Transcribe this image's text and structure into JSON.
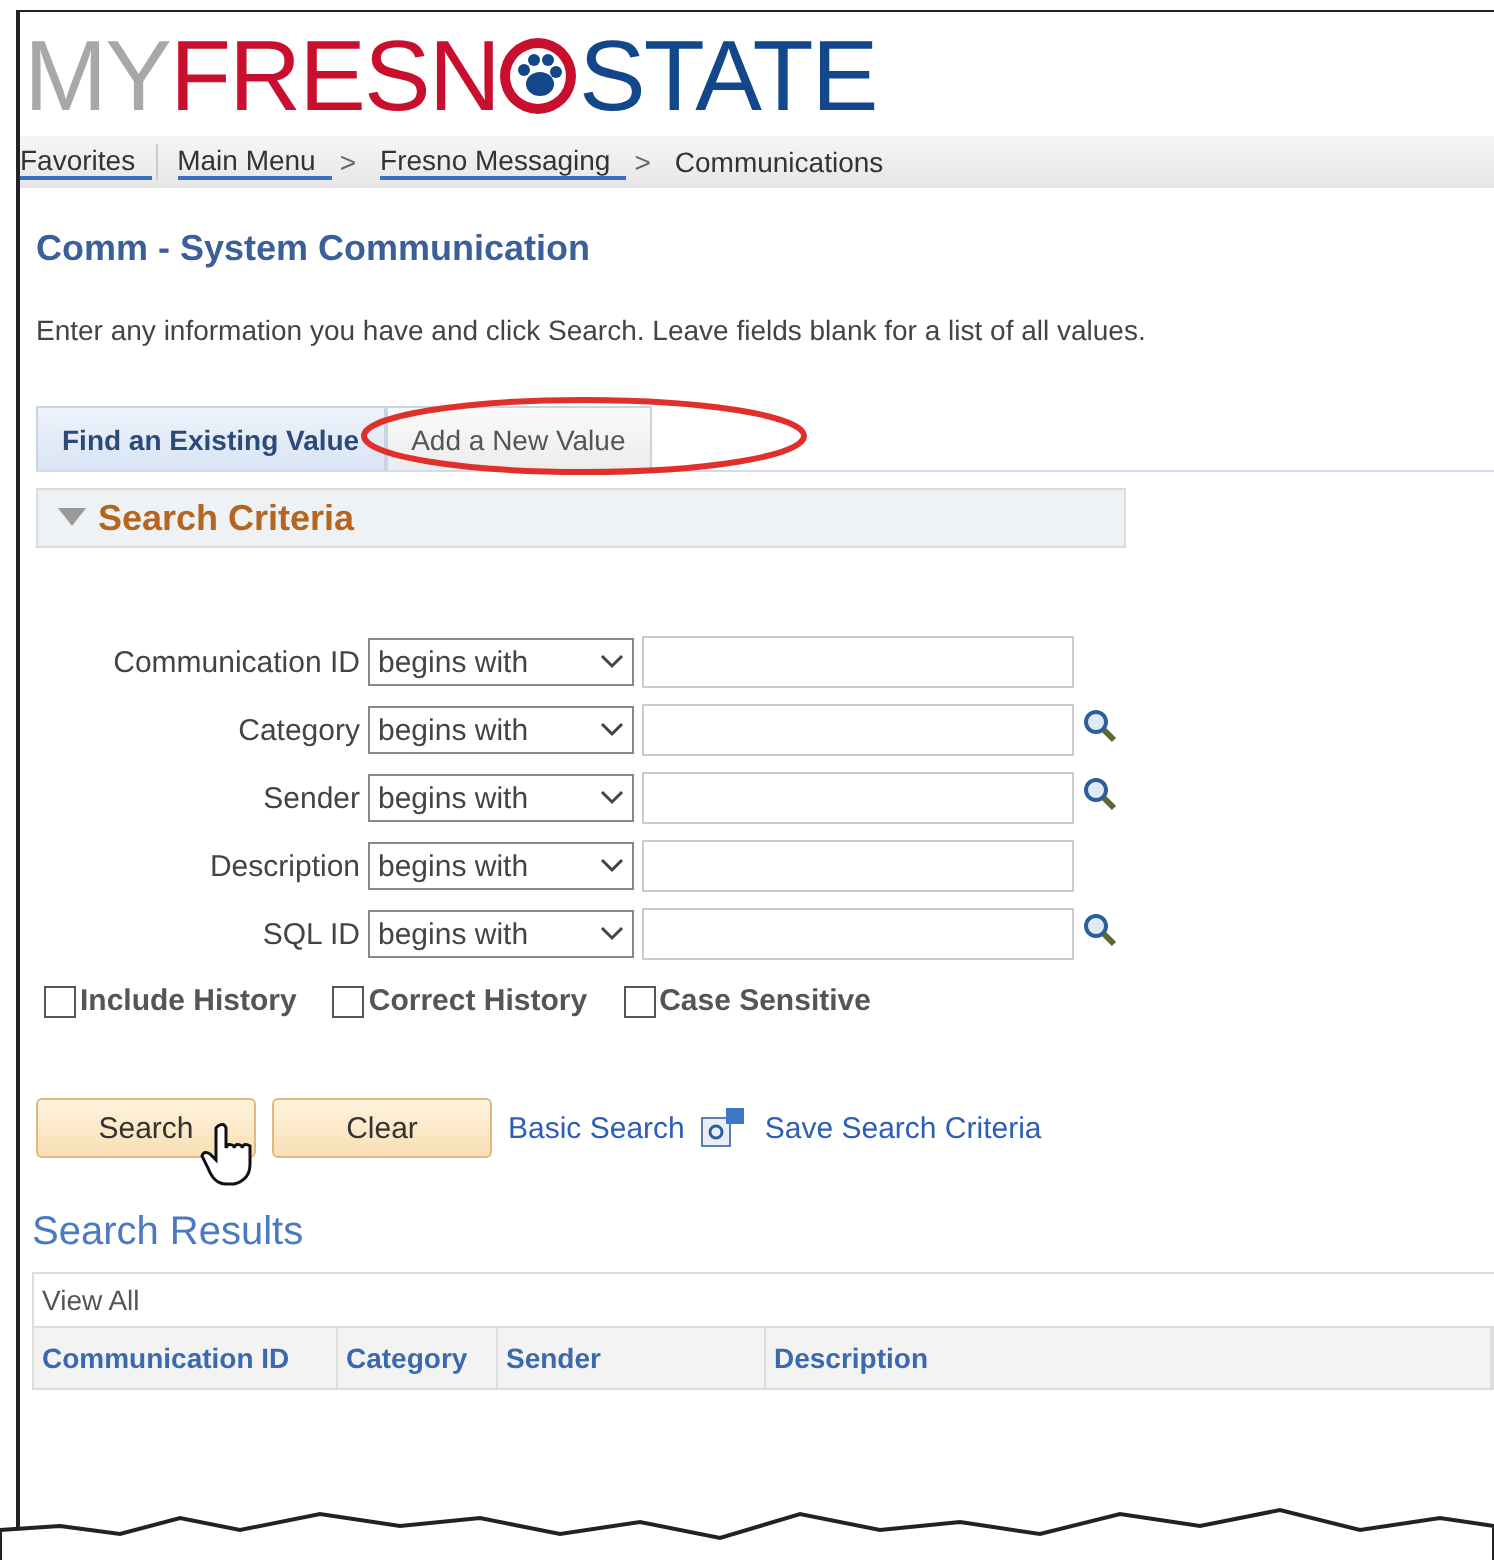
{
  "logo": {
    "my": "MY",
    "fresno": "FRESN",
    "state": "STATE"
  },
  "nav": [
    {
      "label": "Favorites",
      "kind": "menu"
    },
    {
      "label": "Main Menu",
      "kind": "menu"
    },
    {
      "label": "Fresno Messaging",
      "kind": "menu"
    },
    {
      "label": "Communications",
      "kind": "crumb"
    }
  ],
  "nav_separator": ">",
  "page_title": "Comm - System Communication",
  "instructions": "Enter any information you have and click Search. Leave fields blank for a list of all values.",
  "tabs": [
    {
      "label": "Find an Existing Value",
      "selected": true,
      "highlighted": false
    },
    {
      "label": "Add a New Value",
      "selected": false,
      "highlighted": true
    }
  ],
  "section": {
    "title": "Search Criteria",
    "expanded": true
  },
  "fields": [
    {
      "label": "Communication ID",
      "operator": "begins with",
      "lookup": false
    },
    {
      "label": "Category",
      "operator": "begins with",
      "lookup": true
    },
    {
      "label": "Sender",
      "operator": "begins with",
      "lookup": true
    },
    {
      "label": "Description",
      "operator": "begins with",
      "lookup": false
    },
    {
      "label": "SQL ID",
      "operator": "begins with",
      "lookup": true
    }
  ],
  "checkboxes": [
    {
      "label": "Include History",
      "checked": false
    },
    {
      "label": "Correct History",
      "checked": false
    },
    {
      "label": "Case Sensitive",
      "checked": false
    }
  ],
  "buttons": [
    "Search",
    "Clear"
  ],
  "links": {
    "basic_search": "Basic Search",
    "save_criteria": "Save Search Criteria"
  },
  "results": {
    "title": "Search Results",
    "view_all": "View All",
    "columns": [
      "Communication ID",
      "Category",
      "Sender",
      "Description"
    ]
  }
}
